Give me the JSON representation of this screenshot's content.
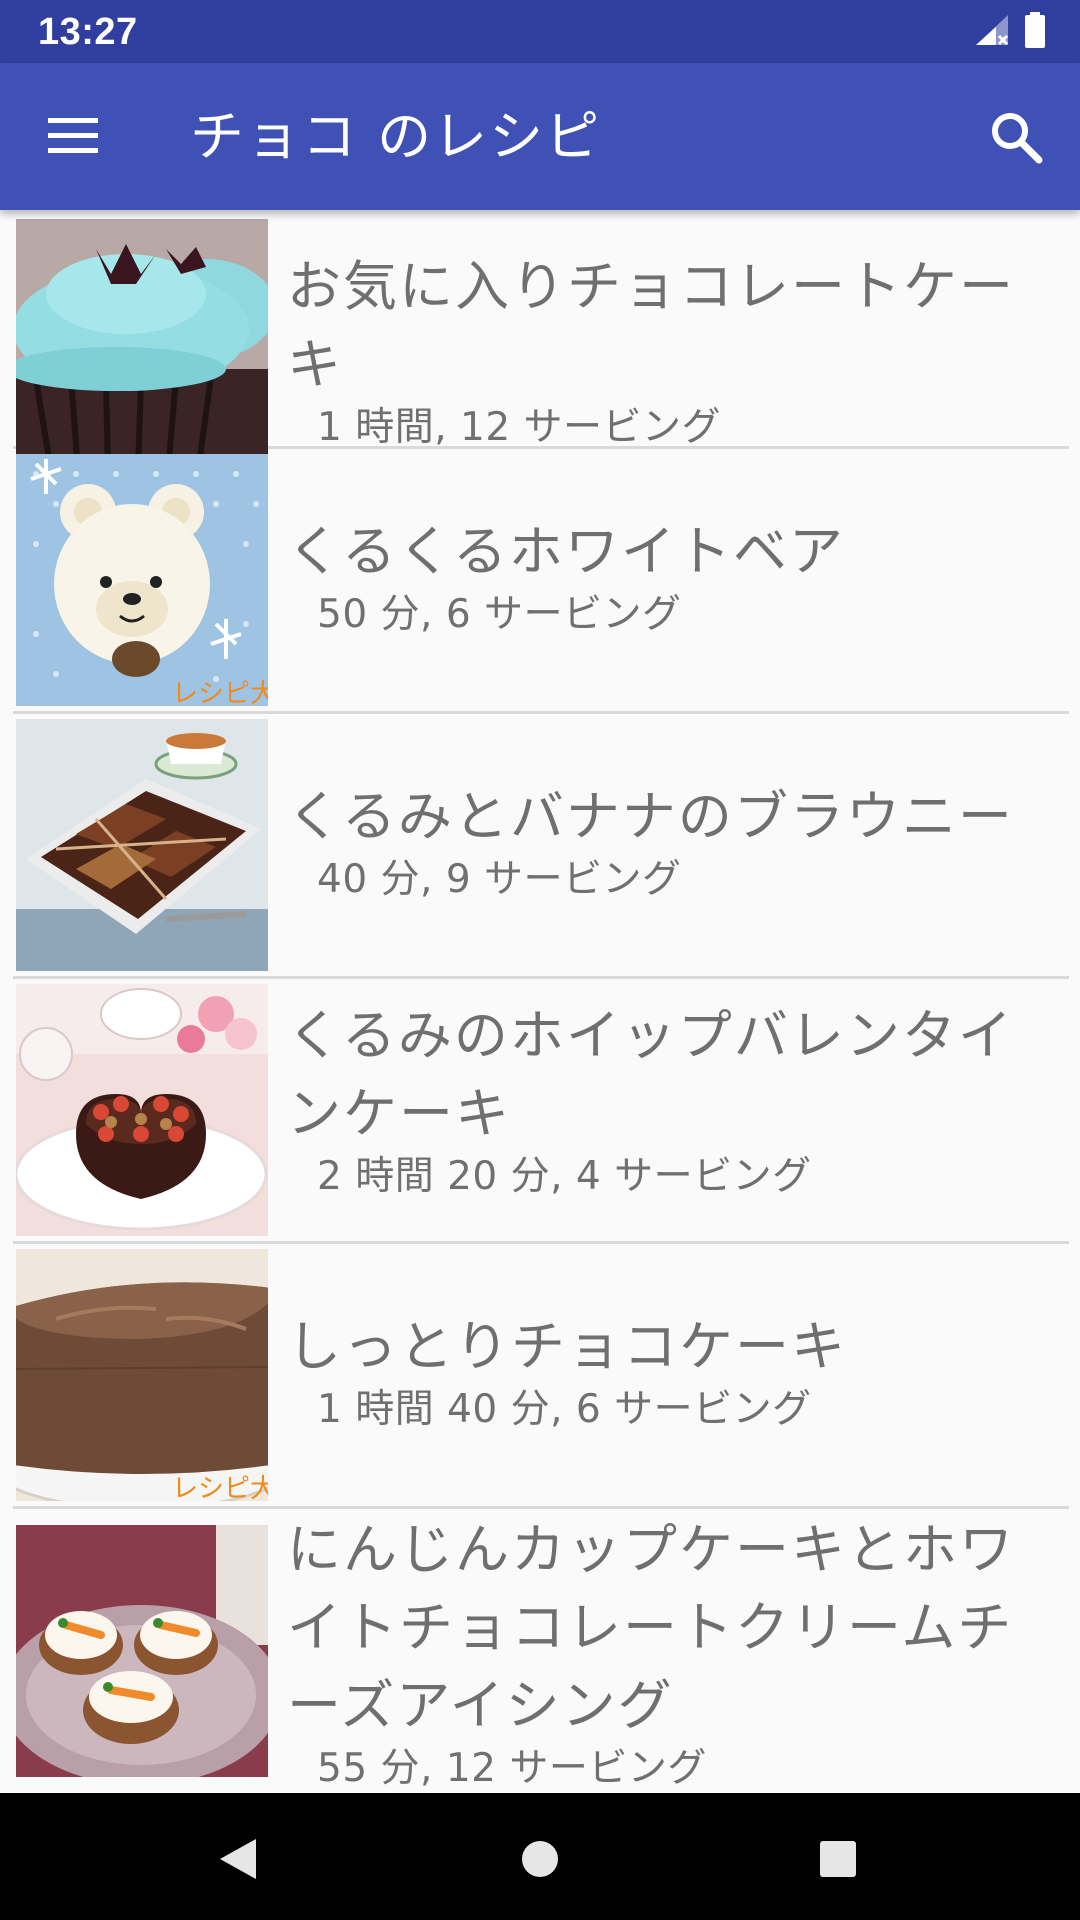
{
  "status_bar": {
    "time": "13:27",
    "icons": [
      "signal-icon",
      "battery-icon"
    ]
  },
  "app_bar": {
    "title": "チョコ のレシピ",
    "background_color": "#3f51b5",
    "icons": [
      "menu-icon",
      "search-icon"
    ]
  },
  "recipes": [
    {
      "title": "お気に入りチョコレートケーキ",
      "meta": "1 時間, 12 サービング",
      "image": "blue-frosted-cupcakes"
    },
    {
      "title": "くるくるホワイトベア",
      "meta": "50 分, 6 サービング",
      "image": "white-bear-cake"
    },
    {
      "title": "くるみとバナナのブラウニー",
      "meta": "40 分, 9 サービング",
      "image": "walnut-brownie"
    },
    {
      "title": "くるみのホイップバレンタインケーキ",
      "meta": "2 時間 20 分, 4 サービング",
      "image": "heart-chocolate-cake"
    },
    {
      "title": "しっとりチョコケーキ",
      "meta": "1 時間 40 分, 6 サービング",
      "image": "chocolate-sponge-cake"
    },
    {
      "title": "にんじんカップケーキとホワイトチョコレートクリームチーズアイシング",
      "meta": "55 分, 12 サービング",
      "image": "carrot-cupcakes"
    }
  ],
  "nav_bar": {
    "icons": [
      "back-icon",
      "home-icon",
      "recents-icon"
    ]
  }
}
